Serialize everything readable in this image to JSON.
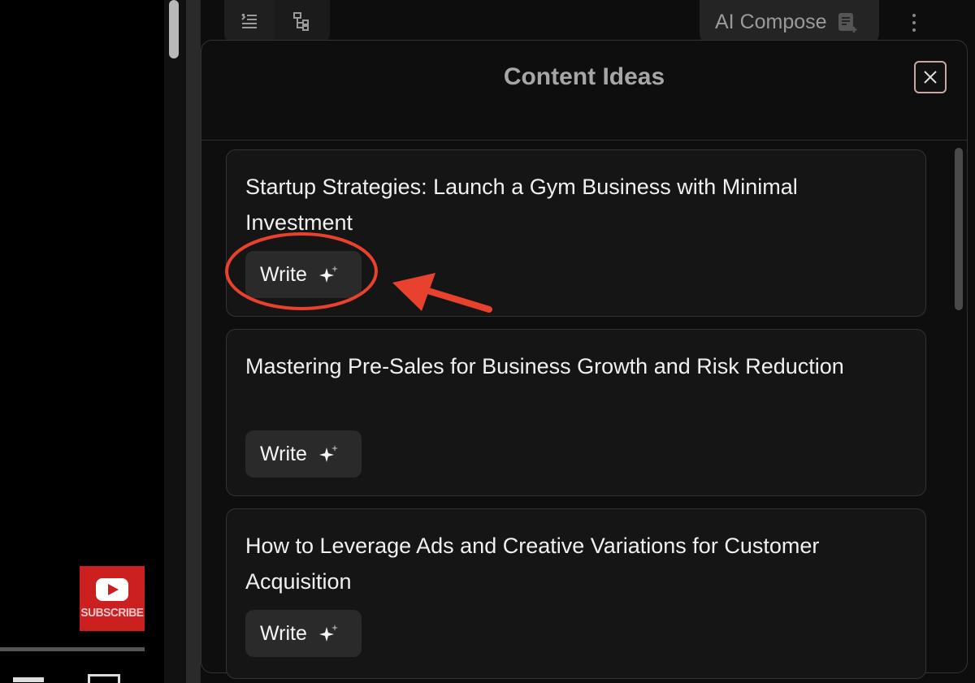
{
  "toolbar": {
    "compose_label": "AI Compose"
  },
  "subscribe_label": "SUBSCRIBE",
  "modal": {
    "title": "Content Ideas"
  },
  "ideas": [
    {
      "title": "Startup Strategies: Launch a Gym Business with Minimal Investment",
      "button": "Write"
    },
    {
      "title": "Mastering Pre-Sales for Business Growth and Risk Reduction",
      "button": "Write"
    },
    {
      "title": "How to Leverage Ads and Creative Variations for Customer Acquisition",
      "button": "Write"
    }
  ],
  "colors": {
    "annotation": "#e8412d",
    "subscribe": "#cc1f1f",
    "close_border": "#c9a7a5"
  }
}
